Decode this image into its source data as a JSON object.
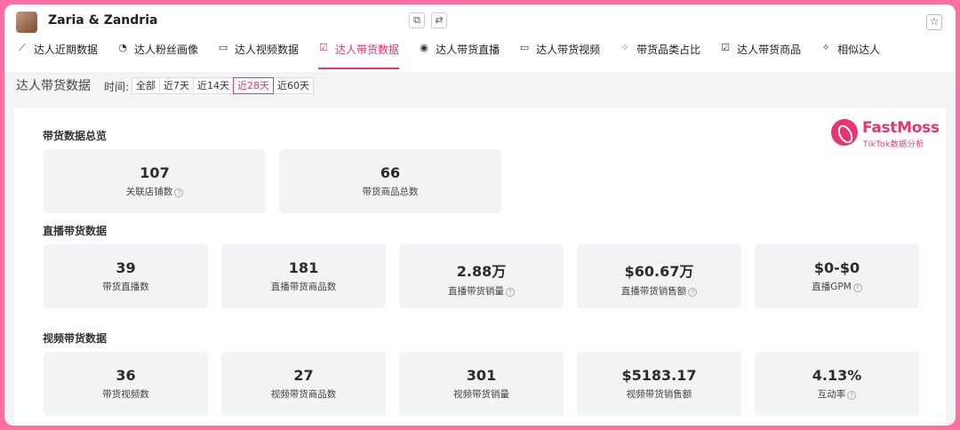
{
  "creator": {
    "name": "Zaria & Zandria"
  },
  "header_icons": {
    "copy": "copy-icon",
    "link": "link-icon",
    "favorite": "star-icon"
  },
  "tabs": [
    {
      "label": "达人近期数据",
      "icon": "line-chart-icon"
    },
    {
      "label": "达人粉丝画像",
      "icon": "pie-chart-icon"
    },
    {
      "label": "达人视频数据",
      "icon": "video-icon"
    },
    {
      "label": "达人带货数据",
      "icon": "cart-icon",
      "active": true
    },
    {
      "label": "达人带货直播",
      "icon": "live-icon"
    },
    {
      "label": "达人带货视频",
      "icon": "video-icon"
    },
    {
      "label": "带货品类占比",
      "icon": "grid-icon"
    },
    {
      "label": "达人带货商品",
      "icon": "bag-icon"
    },
    {
      "label": "相似达人",
      "icon": "similar-icon"
    }
  ],
  "page": {
    "title": "达人带货数据",
    "time_label": "时间:"
  },
  "time_filter": [
    "全部",
    "近7天",
    "近14天",
    "近28天",
    "近60天"
  ],
  "time_filter_selected": "近28天",
  "brand": {
    "name": "FastMoss",
    "sub": "TikTok数据分析"
  },
  "overview": {
    "title": "带货数据总览",
    "cards": [
      {
        "value": "107",
        "label": "关联店铺数",
        "help": true
      },
      {
        "value": "66",
        "label": "带货商品总数",
        "help": false
      }
    ]
  },
  "live": {
    "title": "直播带货数据",
    "cards": [
      {
        "value": "39",
        "label": "带货直播数",
        "help": false
      },
      {
        "value": "181",
        "label": "直播带货商品数",
        "help": false
      },
      {
        "value": "2.88万",
        "label": "直播带货销量",
        "help": true
      },
      {
        "value": "$60.67万",
        "label": "直播带货销售额",
        "help": true
      },
      {
        "value": "$0-$0",
        "label": "直播GPM",
        "help": true
      }
    ]
  },
  "video": {
    "title": "视频带货数据",
    "cards": [
      {
        "value": "36",
        "label": "带货视频数",
        "help": false
      },
      {
        "value": "27",
        "label": "视频带货商品数",
        "help": false
      },
      {
        "value": "301",
        "label": "视频带货销量",
        "help": false
      },
      {
        "value": "$5183.17",
        "label": "视频带货销售额",
        "help": false
      },
      {
        "value": "4.13%",
        "label": "互动率",
        "help": true
      }
    ]
  },
  "colors": {
    "accent": "#e8346f",
    "frame": "#ff6fa0",
    "card_bg": "#f3f3f6"
  }
}
